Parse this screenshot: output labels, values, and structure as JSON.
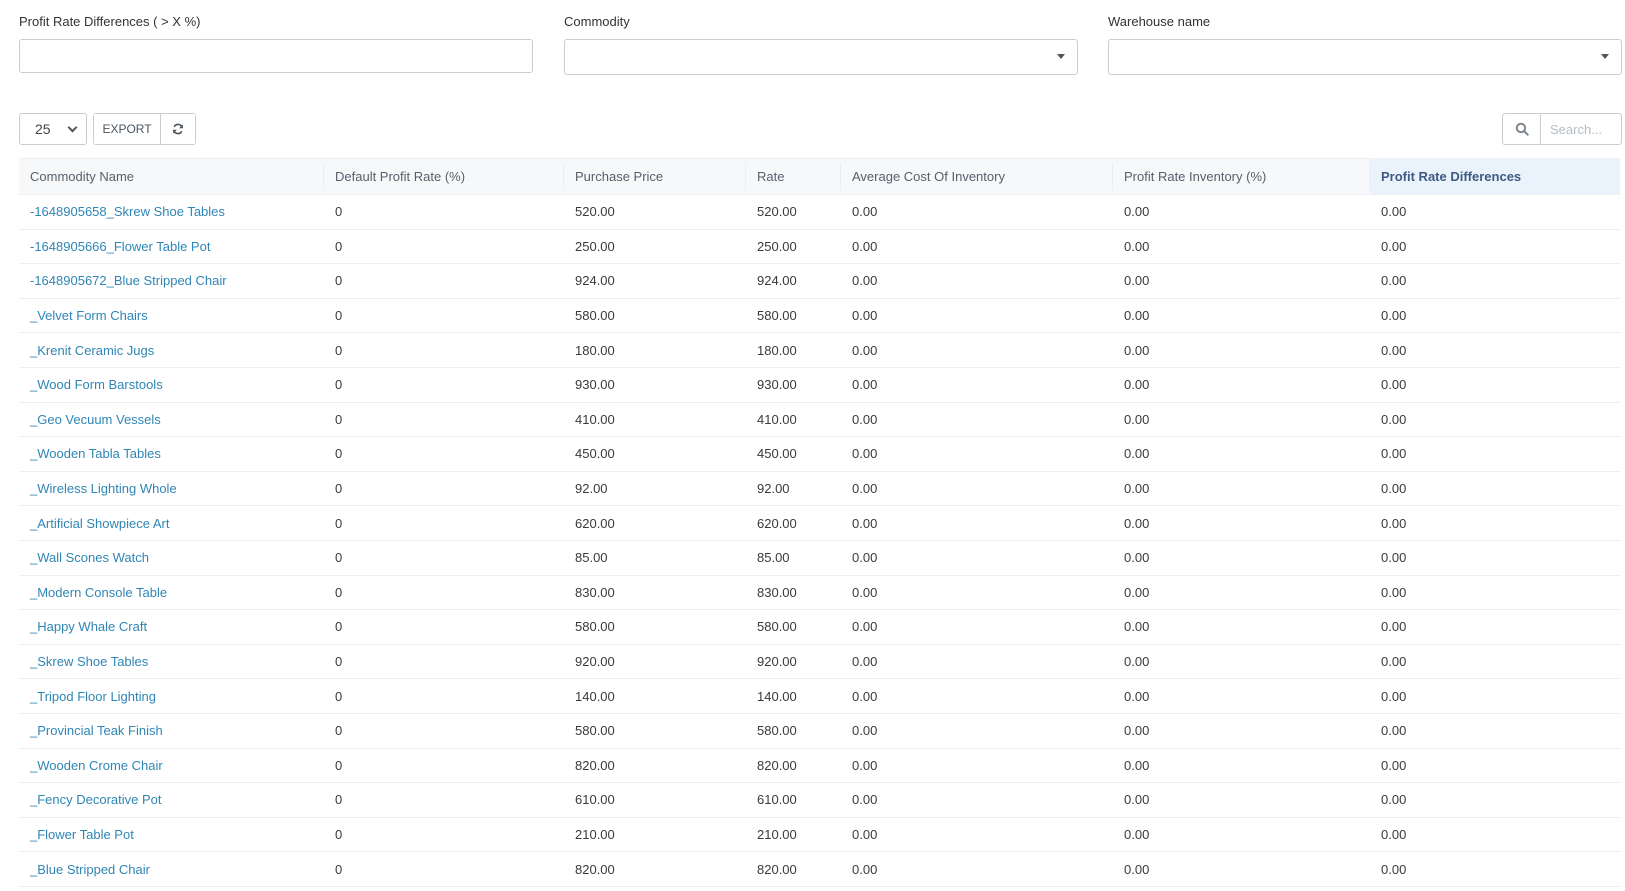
{
  "filters": {
    "profit_rate_diff": {
      "label": "Profit Rate Differences ( > X %)",
      "value": "",
      "placeholder": ""
    },
    "commodity": {
      "label": "Commodity",
      "selected": ""
    },
    "warehouse": {
      "label": "Warehouse name",
      "selected": ""
    }
  },
  "toolbar": {
    "page_size": "25",
    "export_label": "EXPORT",
    "refresh_icon": "refresh-icon",
    "search_icon": "search-icon",
    "search_placeholder": "Search..."
  },
  "colors": {
    "link": "#2f86b5",
    "header_bg": "#f6f8fa",
    "sorted_header_bg": "#eaf3fc"
  },
  "table": {
    "sorted_column": "Profit Rate Differences",
    "columns": [
      "Commodity Name",
      "Default Profit Rate (%)",
      "Purchase Price",
      "Rate",
      "Average Cost Of Inventory",
      "Profit Rate Inventory (%)",
      "Profit Rate Differences"
    ],
    "rows": [
      [
        "-1648905658_Skrew Shoe Tables",
        "0",
        "520.00",
        "520.00",
        "0.00",
        "0.00",
        "0.00"
      ],
      [
        "-1648905666_Flower Table Pot",
        "0",
        "250.00",
        "250.00",
        "0.00",
        "0.00",
        "0.00"
      ],
      [
        "-1648905672_Blue Stripped Chair",
        "0",
        "924.00",
        "924.00",
        "0.00",
        "0.00",
        "0.00"
      ],
      [
        "_Velvet Form Chairs",
        "0",
        "580.00",
        "580.00",
        "0.00",
        "0.00",
        "0.00"
      ],
      [
        "_Krenit Ceramic Jugs",
        "0",
        "180.00",
        "180.00",
        "0.00",
        "0.00",
        "0.00"
      ],
      [
        "_Wood Form Barstools",
        "0",
        "930.00",
        "930.00",
        "0.00",
        "0.00",
        "0.00"
      ],
      [
        "_Geo Vecuum Vessels",
        "0",
        "410.00",
        "410.00",
        "0.00",
        "0.00",
        "0.00"
      ],
      [
        "_Wooden Tabla Tables",
        "0",
        "450.00",
        "450.00",
        "0.00",
        "0.00",
        "0.00"
      ],
      [
        "_Wireless Lighting Whole",
        "0",
        "92.00",
        "92.00",
        "0.00",
        "0.00",
        "0.00"
      ],
      [
        "_Artificial Showpiece Art",
        "0",
        "620.00",
        "620.00",
        "0.00",
        "0.00",
        "0.00"
      ],
      [
        "_Wall Scones Watch",
        "0",
        "85.00",
        "85.00",
        "0.00",
        "0.00",
        "0.00"
      ],
      [
        "_Modern Console Table",
        "0",
        "830.00",
        "830.00",
        "0.00",
        "0.00",
        "0.00"
      ],
      [
        "_Happy Whale Craft",
        "0",
        "580.00",
        "580.00",
        "0.00",
        "0.00",
        "0.00"
      ],
      [
        "_Skrew Shoe Tables",
        "0",
        "920.00",
        "920.00",
        "0.00",
        "0.00",
        "0.00"
      ],
      [
        "_Tripod Floor Lighting",
        "0",
        "140.00",
        "140.00",
        "0.00",
        "0.00",
        "0.00"
      ],
      [
        "_Provincial Teak Finish",
        "0",
        "580.00",
        "580.00",
        "0.00",
        "0.00",
        "0.00"
      ],
      [
        "_Wooden Crome Chair",
        "0",
        "820.00",
        "820.00",
        "0.00",
        "0.00",
        "0.00"
      ],
      [
        "_Fency Decorative Pot",
        "0",
        "610.00",
        "610.00",
        "0.00",
        "0.00",
        "0.00"
      ],
      [
        "_Flower Table Pot",
        "0",
        "210.00",
        "210.00",
        "0.00",
        "0.00",
        "0.00"
      ],
      [
        "_Blue Stripped Chair",
        "0",
        "820.00",
        "820.00",
        "0.00",
        "0.00",
        "0.00"
      ]
    ]
  }
}
